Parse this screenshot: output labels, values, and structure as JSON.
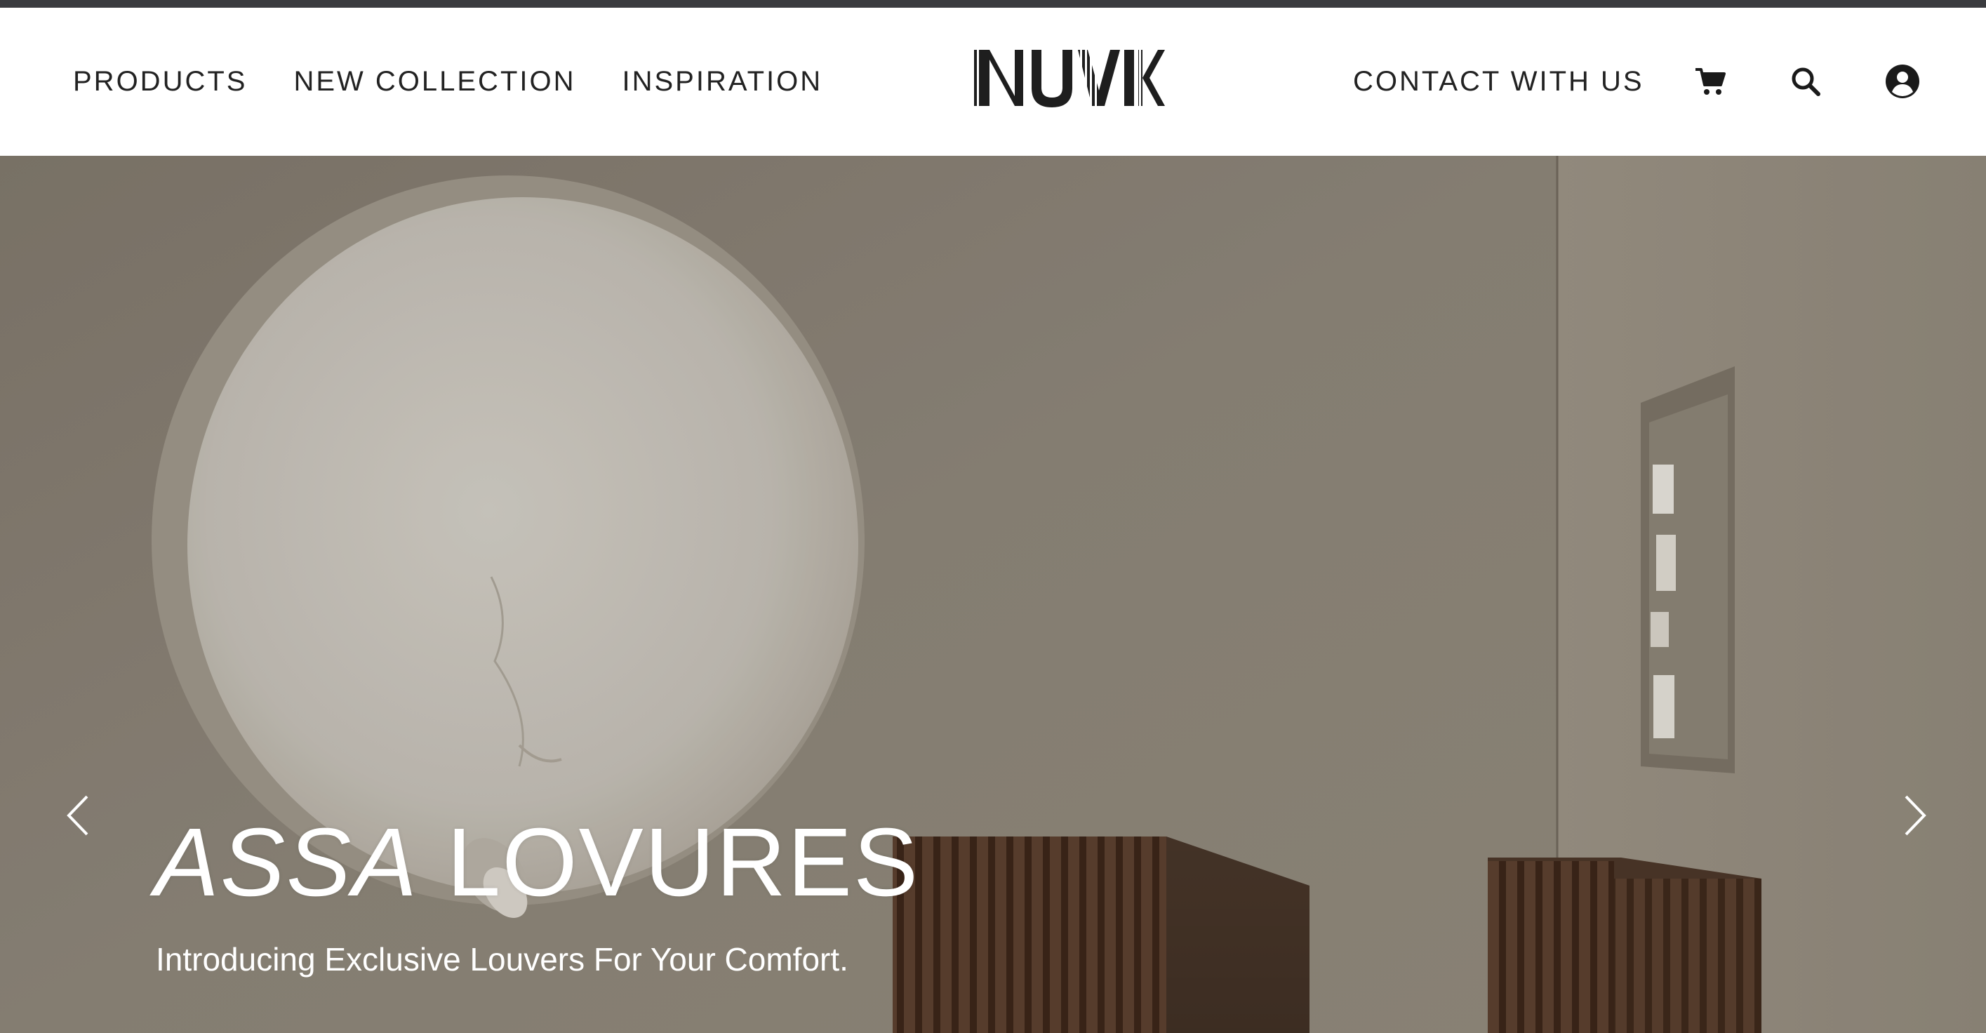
{
  "header": {
    "nav_left": [
      {
        "label": "PRODUCTS"
      },
      {
        "label": "NEW COLLECTION"
      },
      {
        "label": "INSPIRATION"
      }
    ],
    "logo": "NUVIK",
    "contact_label": "CONTACT WITH US",
    "icons": [
      "cart-icon",
      "search-icon",
      "user-account-icon"
    ]
  },
  "hero": {
    "title_first": "ASSA",
    "title_second": "LOVURES",
    "subtitle": "Introducing Exclusive Louvers For Your Comfort.",
    "prev_icon": "chevron-left-icon",
    "next_icon": "chevron-right-icon"
  },
  "colors": {
    "topbar": "#3a3b3f",
    "header_bg": "#ffffff",
    "nav_text": "#222222",
    "hero_text": "#ffffff"
  }
}
